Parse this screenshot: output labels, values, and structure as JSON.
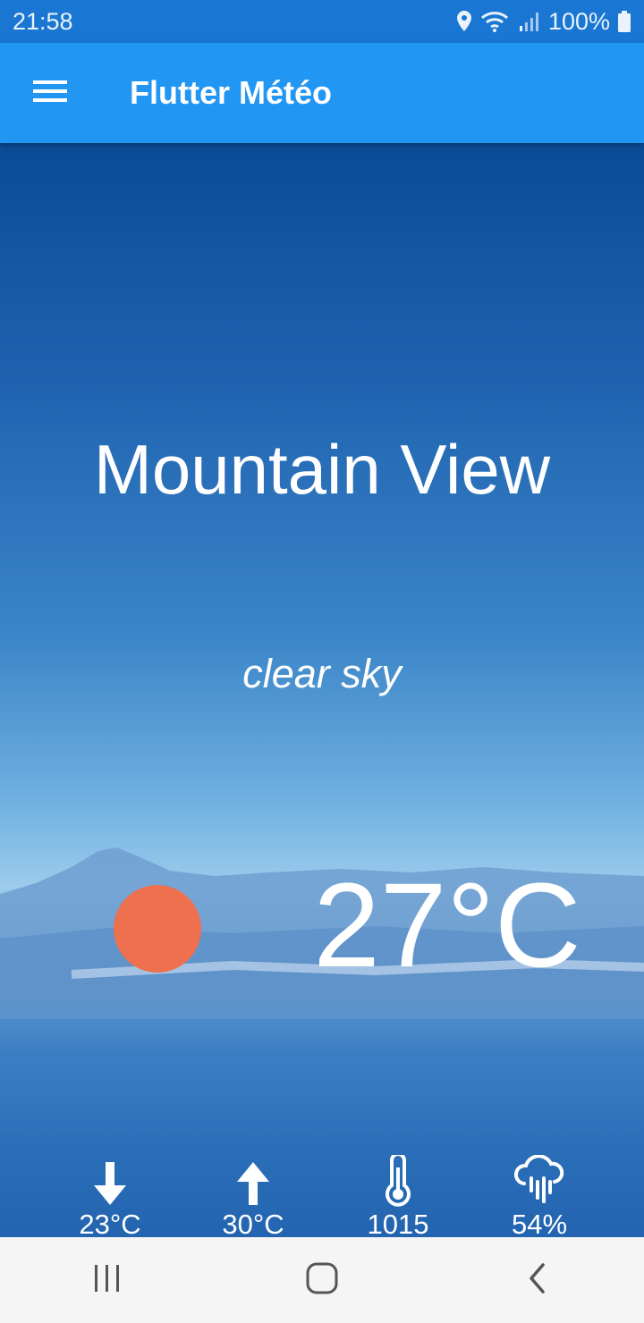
{
  "status_bar": {
    "time": "21:58",
    "battery": "100%",
    "icons": [
      "location-icon",
      "wifi-icon",
      "signal-icon",
      "battery-icon"
    ]
  },
  "app_bar": {
    "title": "Flutter Météo",
    "menu_icon": "menu-icon"
  },
  "weather": {
    "city": "Mountain View",
    "description": "clear sky",
    "temperature": "27°C",
    "condition_icon": "sun-icon",
    "sun_color": "#ee704e"
  },
  "stats": [
    {
      "icon": "arrow-down-icon",
      "value": "23°C"
    },
    {
      "icon": "arrow-up-icon",
      "value": "30°C"
    },
    {
      "icon": "thermometer-icon",
      "value": "1015"
    },
    {
      "icon": "rain-cloud-icon",
      "value": "54%"
    }
  ],
  "nav_bar": {
    "buttons": [
      "recent-apps-icon",
      "home-icon",
      "back-icon"
    ]
  },
  "colors": {
    "app_bar": "#2196f3",
    "status_bar": "#1976d2",
    "nav_bar": "#f5f5f5"
  }
}
